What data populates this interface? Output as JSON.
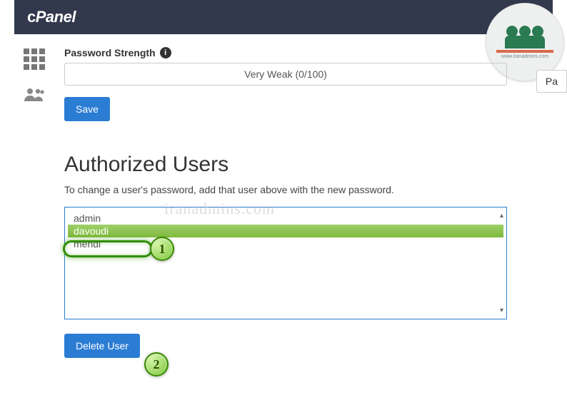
{
  "header": {
    "brand": "cPanel"
  },
  "password": {
    "strength_label": "Password Strength",
    "strength_value": "Very Weak (0/100)",
    "right_button": "Pa",
    "save_label": "Save"
  },
  "section": {
    "heading": "Authorized Users",
    "subtext": "To change a user's password, add that user above with the new password."
  },
  "users": {
    "items": [
      "admin",
      "davoudi",
      "mehdi"
    ],
    "selected_index": 1
  },
  "actions": {
    "delete_label": "Delete User"
  },
  "callouts": {
    "one": "1",
    "two": "2"
  },
  "watermark": "iranadmins.com",
  "logo_sub": "www.iranadmins.com"
}
